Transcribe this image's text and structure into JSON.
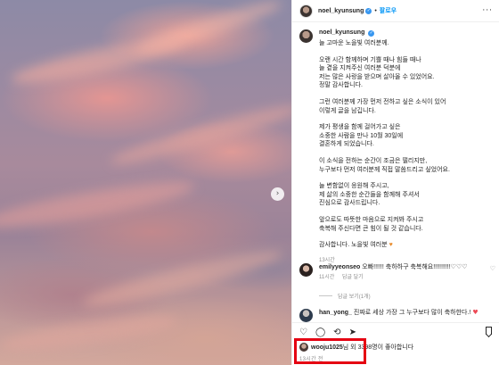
{
  "header": {
    "username": "noel_kyunsung",
    "dot": "•",
    "follow_label": "팔로우",
    "more_icon": "more-horizontal-icon"
  },
  "caption": {
    "username": "noel_kyunsung",
    "paragraphs": [
      "늘 고마운 노을빛 여러분께.",
      "오랜 시간 함께하며 기쁠 때나 힘들 때나\n늘 곁을 지켜주신 여러분 덕분에\n저는 많은 사랑을 받으며 살아올 수 있었어요.\n정말 감사합니다.",
      "그런 여러분께 가장 먼저 전하고 싶은 소식이 있어\n이렇게 글을 남깁니다.",
      "제가 평생을 함께 걸어가고 싶은\n소중한 사람을 만나 10월 30일에\n결혼하게 되었습니다.",
      "이 소식을 전하는 순간이 조금은 떨리지만,\n누구보다 먼저 여러분께 직접 말씀드리고 싶었어요.",
      "늘 변함없이 응원해 주시고,\n제 삶의 소중한 순간들을 함께해 주셔서\n진심으로 감사드립니다.",
      "앞으로도 따뜻한 마음으로 지켜봐 주시고\n축복해 주신다면 큰 힘이 될 것 같습니다."
    ],
    "closing_text": "감사합니다. 노을빛 여러분",
    "closing_heart": "♥",
    "time": "13시간"
  },
  "comments": [
    {
      "username": "emilyyeonseo",
      "text": "오빠!!!!!! 축하하구 축복해요!!!!!!!!!!♡♡♡",
      "time": "11시간",
      "reply_label": "답글 달기",
      "view_replies": "답글 보기(1개)"
    },
    {
      "username": "han_yong_",
      "text": "진짜로 세상 가장 그 누구보다 많이 축하한다.!",
      "heart": "♥"
    }
  ],
  "actions": {
    "like_icon": "heart-icon",
    "comment_icon": "comment-icon",
    "share_icon": "share-icon",
    "save_icon": "bookmark-icon"
  },
  "likes": {
    "liked_by_user": "wooju1025",
    "text": "님 외 3398명이 좋아합니다"
  },
  "post_date": "13시간 전",
  "colors": {
    "link_blue": "#0095f6",
    "verified_blue": "#3897f0",
    "highlight_red": "#e50012"
  }
}
